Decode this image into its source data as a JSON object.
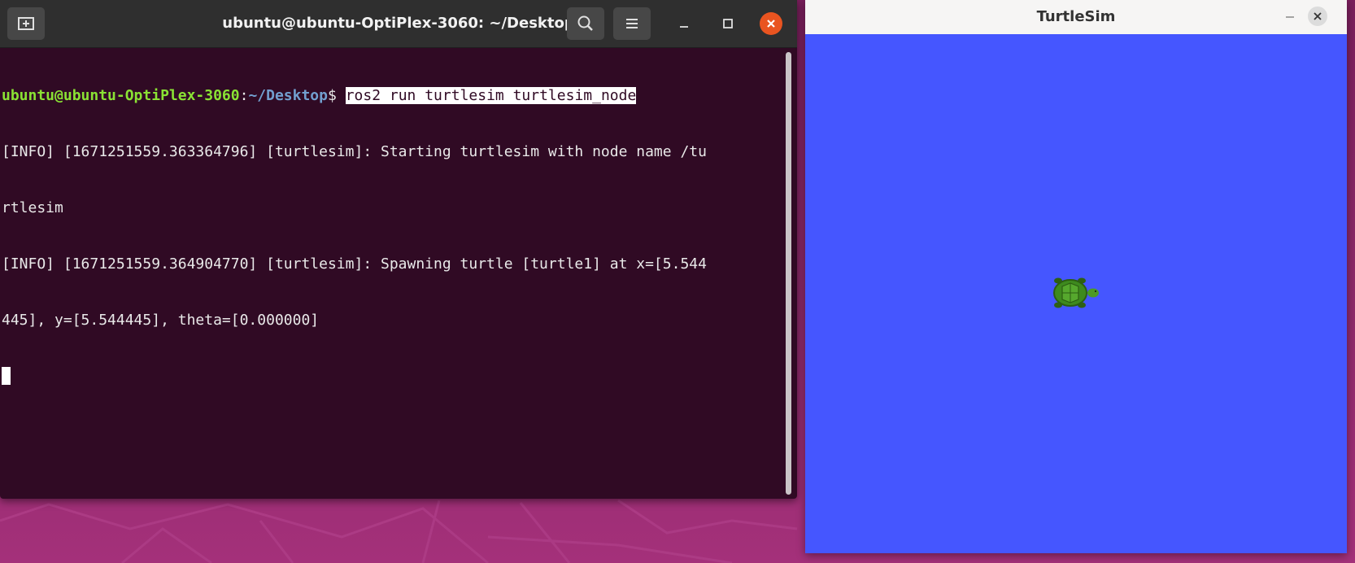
{
  "terminal": {
    "title": "ubuntu@ubuntu-OptiPlex-3060: ~/Desktop",
    "prompt_user": "ubuntu@ubuntu-OptiPlex-3060",
    "prompt_sep": ":",
    "prompt_path": "~/Desktop",
    "prompt_dollar": "$ ",
    "command": "ros2 run turtlesim turtlesim_node",
    "output_lines": [
      "[INFO] [1671251559.363364796] [turtlesim]: Starting turtlesim with node name /tu",
      "rtlesim",
      "[INFO] [1671251559.364904770] [turtlesim]: Spawning turtle [turtle1] at x=[5.544",
      "445], y=[5.544445], theta=[0.000000]"
    ],
    "icons": {
      "new_tab": "new-tab-icon",
      "search": "search-icon",
      "menu": "hamburger-menu-icon",
      "minimize": "minimize-icon",
      "maximize": "maximize-icon",
      "close": "close-icon"
    },
    "colors": {
      "background": "#300a24",
      "prompt_user": "#8ae234",
      "prompt_path": "#729fcf",
      "close": "#e95420"
    }
  },
  "turtlesim": {
    "title": "TurtleSim",
    "icons": {
      "minimize": "minimize-icon",
      "close": "close-icon",
      "turtle": "turtle-icon"
    },
    "colors": {
      "canvas": "#4556ff",
      "turtle": "#3e8a1e"
    }
  }
}
